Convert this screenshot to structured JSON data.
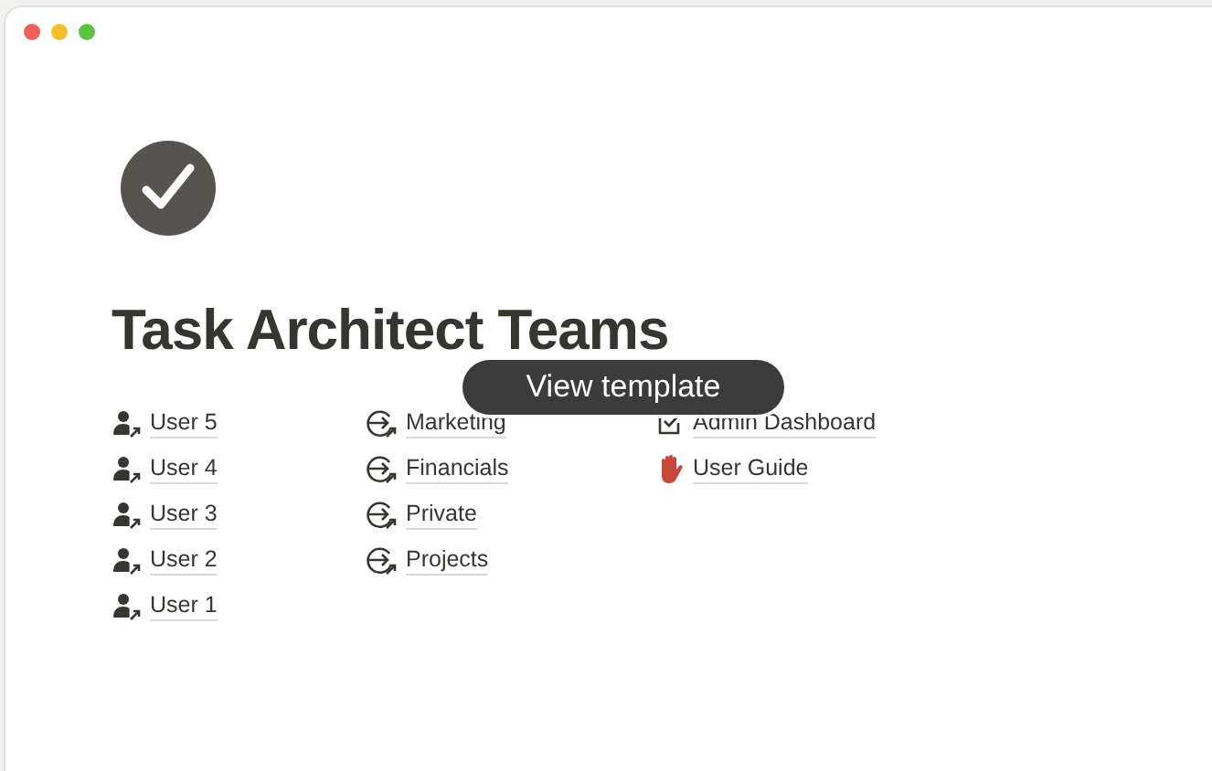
{
  "page": {
    "title": "Task Architect Teams"
  },
  "columns": [
    [
      {
        "kind": "user",
        "label": "User 5"
      },
      {
        "kind": "user",
        "label": "User 4"
      },
      {
        "kind": "user",
        "label": "User 3"
      },
      {
        "kind": "user",
        "label": "User 2"
      },
      {
        "kind": "user",
        "label": "User 1"
      }
    ],
    [
      {
        "kind": "team",
        "label": "Marketing"
      },
      {
        "kind": "team",
        "label": "Financials"
      },
      {
        "kind": "team",
        "label": "Private"
      },
      {
        "kind": "team",
        "label": "Projects"
      }
    ],
    [
      {
        "kind": "dashboard",
        "label": "Admin Dashboard"
      },
      {
        "kind": "guide",
        "label": "User Guide"
      }
    ]
  ],
  "overlay_button": "View template"
}
